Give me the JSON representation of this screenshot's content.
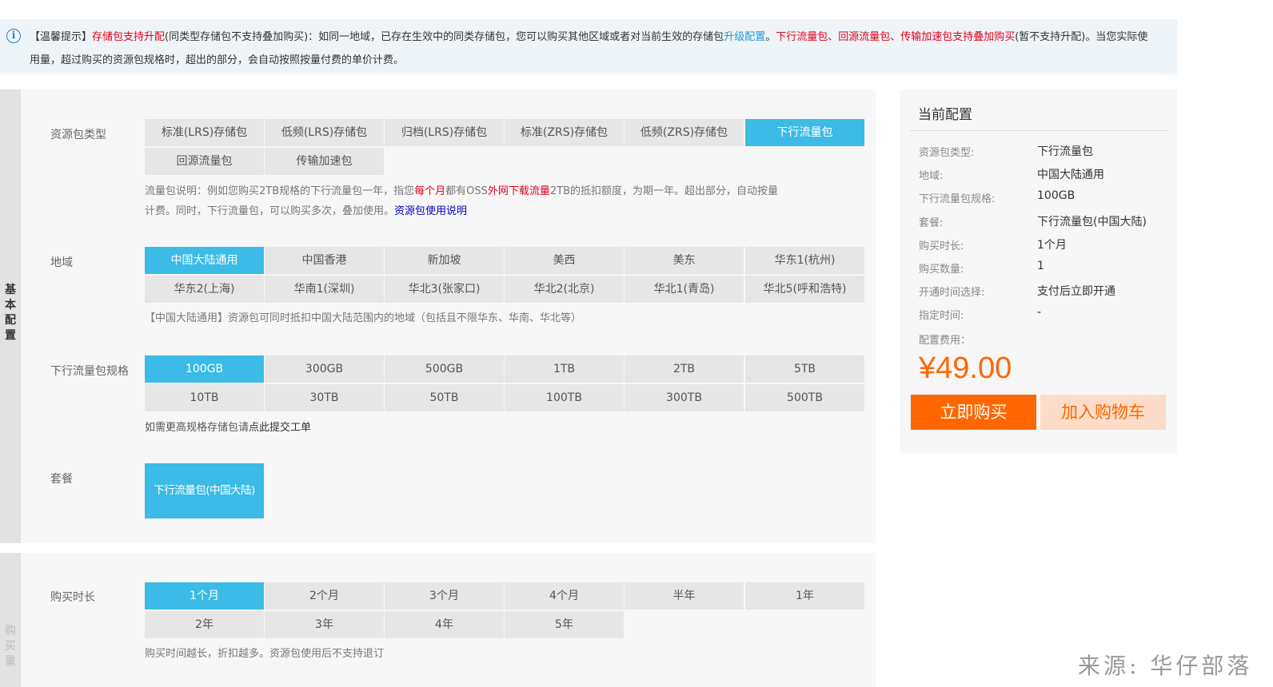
{
  "notice": {
    "tag": "【温馨提示】",
    "part1_red": "存储包支持升配",
    "part2": "(同类型存储包不支持叠加购买)：如同一地域，已存在生效中的同类存储包，您可以购买其他区域或者对当前生效的存储包",
    "part3_link": "升级配置",
    "part4": "。",
    "part5_red": "下行流量包、回源流量包、传输加速包支持叠加购买",
    "part6": "(暂不支持升配)。当您实际使用量，超过购买的资源包规格时，超出的部分，会自动按照按量付费的单价计费。"
  },
  "basic_section": {
    "side_label": [
      "基",
      "本",
      "配",
      "置"
    ],
    "package_type": {
      "label": "资源包类型",
      "options": [
        "标准(LRS)存储包",
        "低频(LRS)存储包",
        "归档(LRS)存储包",
        "标准(ZRS)存储包",
        "低频(ZRS)存储包",
        "下行流量包",
        "回源流量包",
        "传输加速包"
      ],
      "selected": 5,
      "desc_a": "流量包说明：例如您购买2TB规格的下行流量包一年，指您",
      "desc_b_red": "每个月",
      "desc_c": "都有OSS",
      "desc_d_red": "外网下载流量",
      "desc_e": "2TB的抵扣额度，为期一年。超出部分，自动按量",
      "desc_f": "计费。同时，下行流量包，可以购买多次，叠加使用。",
      "desc_link": "资源包使用说明"
    },
    "region": {
      "label": "地域",
      "options": [
        "中国大陆通用",
        "中国香港",
        "新加坡",
        "美西",
        "美东",
        "华东1(杭州)",
        "华东2(上海)",
        "华南1(深圳)",
        "华北3(张家口)",
        "华北2(北京)",
        "华北1(青岛)",
        "华北5(呼和浩特)"
      ],
      "selected": 0,
      "hint": "【中国大陆通用】资源包可同时抵扣中国大陆范围内的地域（包括且不限华东、华南、华北等）"
    },
    "spec": {
      "label": "下行流量包规格",
      "options": [
        "100GB",
        "300GB",
        "500GB",
        "1TB",
        "2TB",
        "5TB",
        "10TB",
        "30TB",
        "50TB",
        "100TB",
        "300TB",
        "500TB"
      ],
      "selected": 0,
      "hint_a": "如需更高规格存储包请",
      "hint_b": "点此提交工单"
    },
    "plan": {
      "label": "套餐",
      "options": [
        "下行流量包(中国大陆)"
      ],
      "selected": 0
    }
  },
  "buy_section": {
    "side_label": [
      "购",
      "买",
      "量"
    ],
    "duration": {
      "label": "购买时长",
      "options": [
        "1个月",
        "2个月",
        "3个月",
        "4个月",
        "半年",
        "1年",
        "2年",
        "3年",
        "4年",
        "5年"
      ],
      "selected": 0,
      "hint": "购买时间越长，折扣越多。资源包使用后不支持退订"
    }
  },
  "summary": {
    "title": "当前配置",
    "rows": [
      {
        "k": "资源包类型:",
        "v": "下行流量包"
      },
      {
        "k": "地域:",
        "v": "中国大陆通用"
      },
      {
        "k": "下行流量包规格:",
        "v": "100GB"
      },
      {
        "k": "套餐:",
        "v": "下行流量包(中国大陆)"
      },
      {
        "k": "购买时长:",
        "v": "1个月"
      },
      {
        "k": "购买数量:",
        "v": "1"
      },
      {
        "k": "开通时间选择:",
        "v": "支付后立即开通"
      },
      {
        "k": "指定时间:",
        "v": "-"
      }
    ],
    "fee_label": "配置费用：",
    "price": "¥49.00",
    "buy_label": "立即购买",
    "cart_label": "加入购物车"
  },
  "watermark": "来源: 华仔部落",
  "colors": {
    "accent": "#3bbbe6",
    "orange": "#ff6600",
    "alert_red": "#e4001b"
  }
}
